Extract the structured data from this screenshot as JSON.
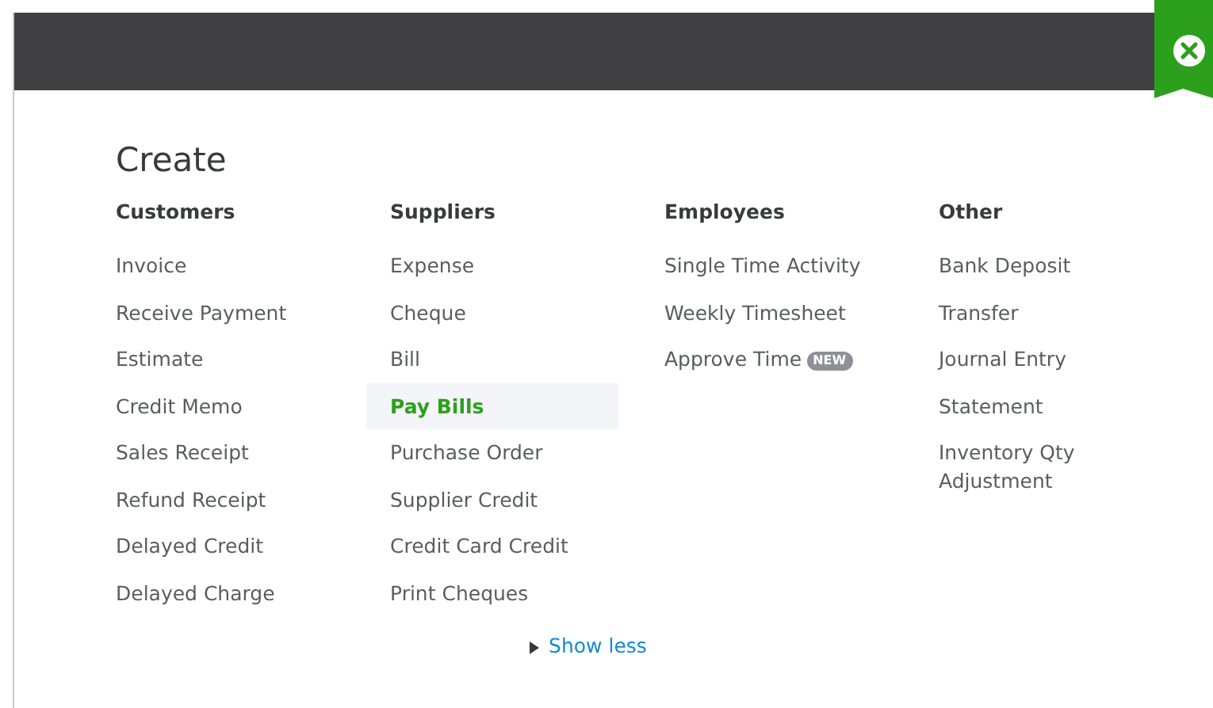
{
  "title": "Create",
  "columns": [
    {
      "heading": "Customers",
      "items": [
        {
          "label": "Invoice",
          "selected": false
        },
        {
          "label": "Receive Payment",
          "selected": false
        },
        {
          "label": "Estimate",
          "selected": false
        },
        {
          "label": "Credit Memo",
          "selected": false
        },
        {
          "label": "Sales Receipt",
          "selected": false
        },
        {
          "label": "Refund Receipt",
          "selected": false
        },
        {
          "label": "Delayed Credit",
          "selected": false
        },
        {
          "label": "Delayed Charge",
          "selected": false
        }
      ]
    },
    {
      "heading": "Suppliers",
      "items": [
        {
          "label": "Expense",
          "selected": false
        },
        {
          "label": "Cheque",
          "selected": false
        },
        {
          "label": "Bill",
          "selected": false
        },
        {
          "label": "Pay Bills",
          "selected": true
        },
        {
          "label": "Purchase Order",
          "selected": false
        },
        {
          "label": "Supplier Credit",
          "selected": false
        },
        {
          "label": "Credit Card Credit",
          "selected": false
        },
        {
          "label": "Print Cheques",
          "selected": false
        }
      ]
    },
    {
      "heading": "Employees",
      "items": [
        {
          "label": "Single Time Activity",
          "selected": false
        },
        {
          "label": "Weekly Timesheet",
          "selected": false
        },
        {
          "label": "Approve Time",
          "selected": false,
          "badge": "NEW"
        }
      ]
    },
    {
      "heading": "Other",
      "items": [
        {
          "label": "Bank Deposit",
          "selected": false
        },
        {
          "label": "Transfer",
          "selected": false
        },
        {
          "label": "Journal Entry",
          "selected": false
        },
        {
          "label": "Statement",
          "selected": false
        },
        {
          "label": "Inventory Qty Adjustment",
          "selected": false
        }
      ]
    }
  ],
  "show_less": "Show less"
}
